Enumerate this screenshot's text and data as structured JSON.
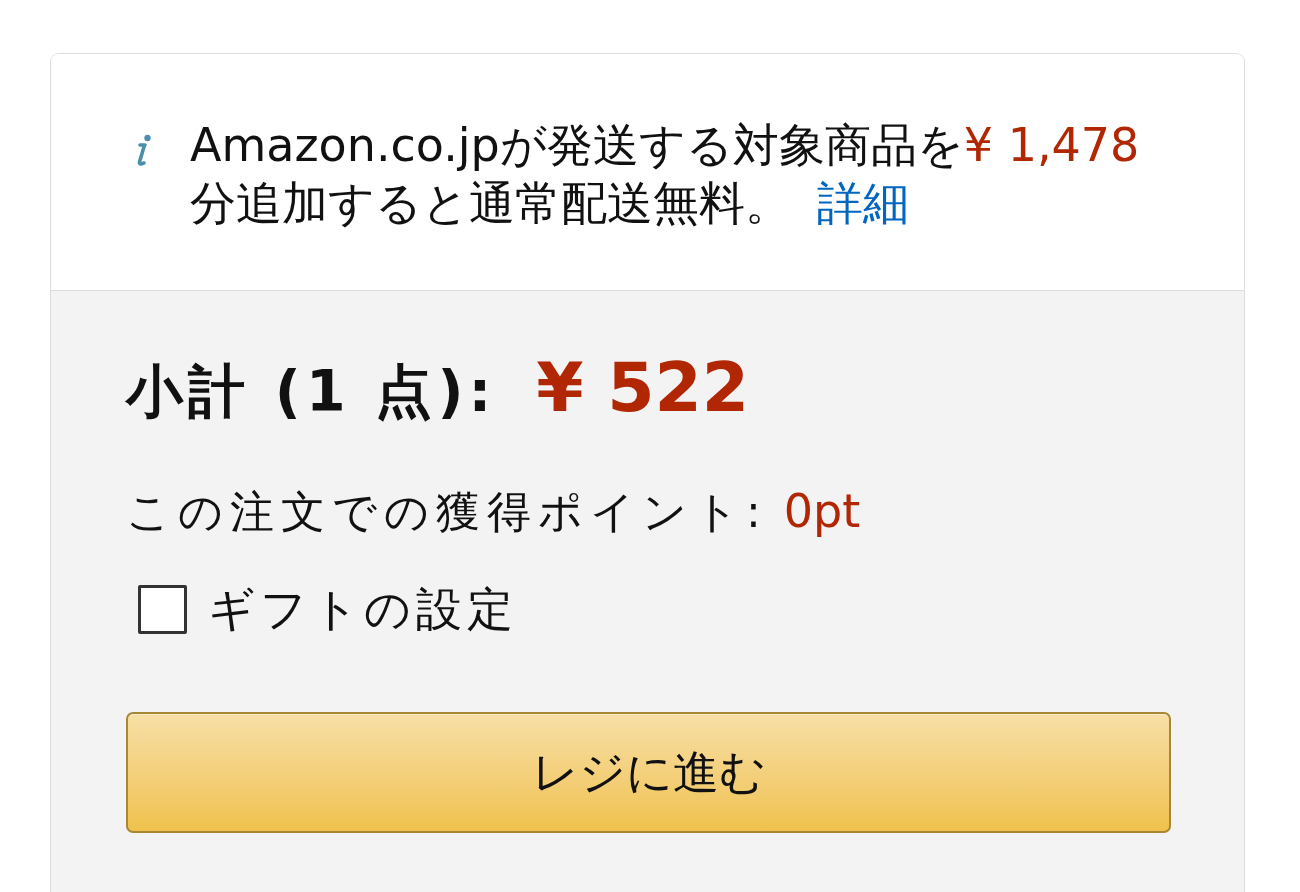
{
  "shipping_notice": {
    "text_before": "Amazon.co.jpが発送する対象商品を",
    "amount": "¥ 1,478",
    "text_after": "分追加すると通常配送無料。",
    "link": "詳細"
  },
  "subtotal": {
    "label": "小計 (1 点):",
    "price": "¥ 522"
  },
  "points": {
    "label": "この注文での獲得ポイント:",
    "value": "0pt"
  },
  "gift_option": {
    "label": "ギフトの設定",
    "checked": false
  },
  "checkout_button": {
    "label": "レジに進む"
  }
}
